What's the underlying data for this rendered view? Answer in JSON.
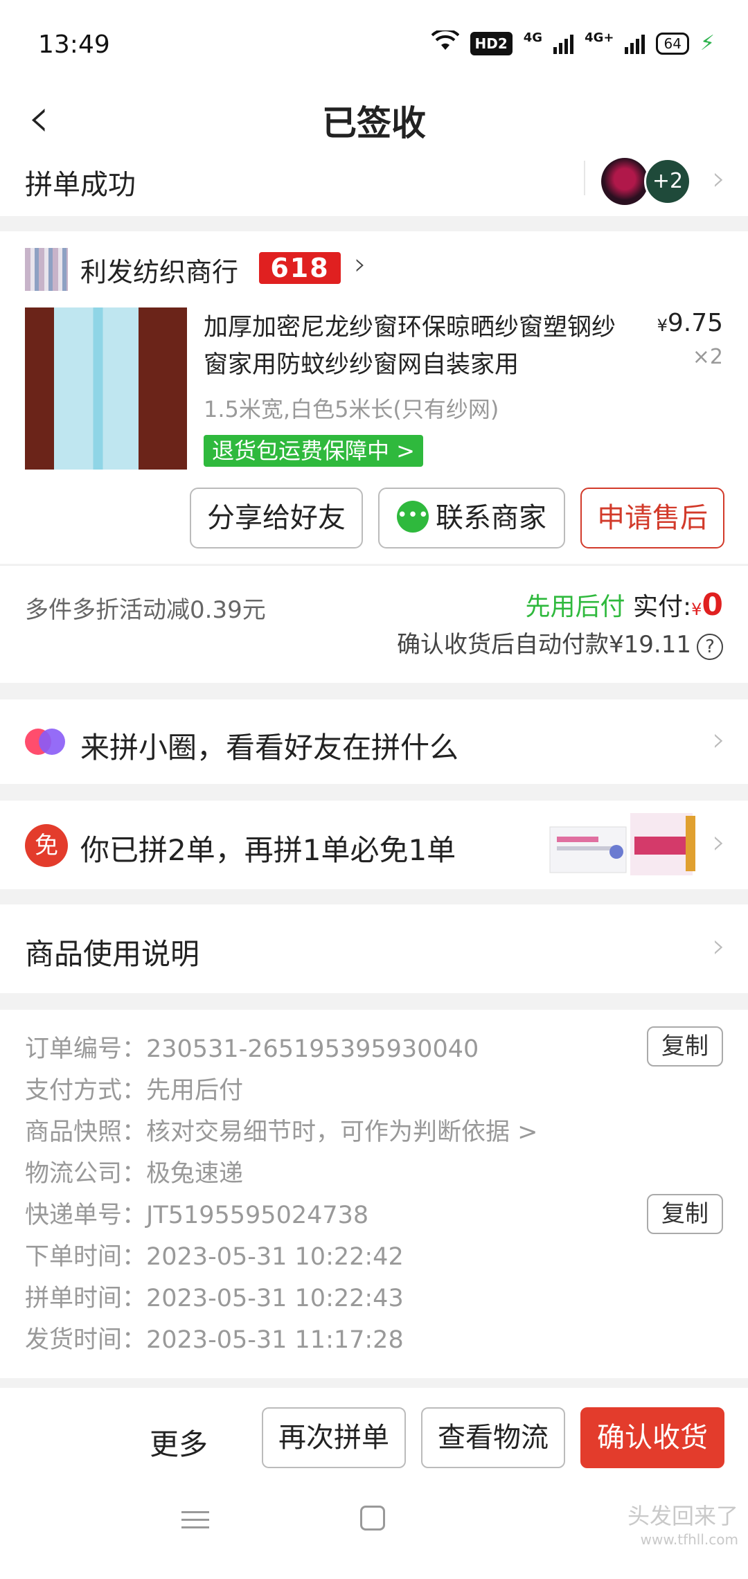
{
  "status_bar": {
    "time": "13:49",
    "hd_label": "HD2",
    "network_1": "4G",
    "network_2": "4G+",
    "battery": "64"
  },
  "nav": {
    "title": "已签收"
  },
  "group": {
    "status": "拼单成功",
    "avatar_count": "+2"
  },
  "store": {
    "name": "利发纺织商行",
    "promo_badge": "618",
    "product": {
      "title": "加厚加密尼龙纱窗环保晾晒纱窗塑钢纱窗家用防蚊纱纱窗网自装家用",
      "price_symbol": "¥",
      "price": "9.75",
      "quantity": "×2",
      "spec": "1.5米宽,白色5米长(只有纱网)",
      "guarantee": "退货包运费保障中 >"
    },
    "buttons": {
      "share": "分享给好友",
      "contact": "联系商家",
      "after_sale": "申请售后"
    }
  },
  "payment": {
    "discount": "多件多折活动减0.39元",
    "pay_later": "先用后付",
    "paid_label": "实付:",
    "paid_symbol": "¥",
    "paid_value": "0",
    "auto_pay": "确认收货后自动付款¥19.11",
    "help": "?"
  },
  "rows": {
    "circle": "来拼小圈，看看好友在拼什么",
    "free_icon": "免",
    "free": "你已拼2单，再拼1单必免1单",
    "usage": "商品使用说明"
  },
  "order_info": {
    "order_no": "订单编号：230531-265195395930040",
    "pay_method": "支付方式：先用后付",
    "snapshot": "商品快照：核对交易细节时，可作为判断依据 >",
    "carrier": "物流公司：极兔速递",
    "tracking": "快递单号：JT5195595024738",
    "order_time": "下单时间：2023-05-31 10:22:42",
    "group_time": "拼单时间：2023-05-31 10:22:43",
    "ship_time": "发货时间：2023-05-31 11:17:28",
    "copy_label": "复制"
  },
  "bottom": {
    "more": "更多",
    "regroup": "再次拼单",
    "logistics": "查看物流",
    "confirm": "确认收货"
  },
  "watermark": {
    "main": "头发回来了",
    "url": "www.tfhll.com"
  },
  "colors": {
    "accent_red": "#e33c2c",
    "green": "#2fb93d",
    "bg": "#f2f2f2"
  },
  "icons": [
    "wifi-icon",
    "signal-icon",
    "battery-icon",
    "back-arrow-icon",
    "chevron-right-icon",
    "wechat-icon",
    "circle-logo-icon",
    "help-icon",
    "menu-key-icon",
    "home-key-icon"
  ]
}
